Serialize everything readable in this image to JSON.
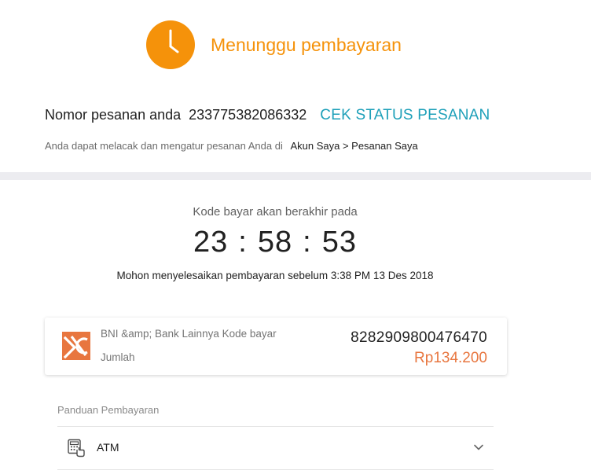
{
  "status": {
    "title": "Menunggu pembayaran",
    "icon": "clock-icon",
    "color": "#f5920a"
  },
  "order": {
    "label": "Nomor pesanan anda",
    "number": "233775382086332",
    "check_link": "CEK STATUS PESANAN"
  },
  "track": {
    "text": "Anda dapat melacak dan mengatur pesanan Anda di",
    "link": "Akun Saya > Pesanan Saya"
  },
  "timer": {
    "label": "Kode bayar akan berakhir pada",
    "hours": "23",
    "minutes": "58",
    "seconds": "53",
    "separator": ":",
    "deadline_text": "Mohon menyelesaikan pembayaran sebelum 3:38 PM 13 Des 2018"
  },
  "payment": {
    "bank_logo": "bni-logo-icon",
    "code_label": "BNI &amp; Bank Lainnya Kode bayar",
    "amount_label": "Jumlah",
    "code_value": "8282909800476470",
    "amount_value": "Rp134.200",
    "accent_color": "#e8763f"
  },
  "guide": {
    "title": "Panduan Pembayaran",
    "items": [
      {
        "label": "ATM",
        "icon": "atm-icon"
      }
    ]
  },
  "colors": {
    "link": "#1ea0b9",
    "divider": "#ececf0"
  }
}
